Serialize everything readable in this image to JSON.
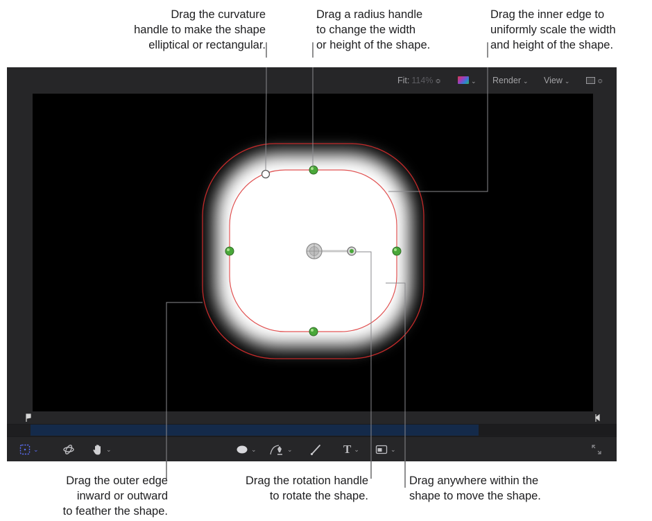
{
  "callouts": {
    "curvature": {
      "lines": [
        "Drag the curvature",
        "handle to make the shape",
        "elliptical or rectangular."
      ]
    },
    "radius": {
      "lines": [
        "Drag a radius handle",
        "to change the width",
        "or height of the shape."
      ]
    },
    "inner_edge": {
      "lines": [
        "Drag the inner edge to",
        "uniformly scale the width",
        "and height of the shape."
      ]
    },
    "outer_edge": {
      "lines": [
        "Drag the outer edge",
        "inward or outward",
        "to feather the shape."
      ]
    },
    "rotation": {
      "lines": [
        "Drag the rotation handle",
        "to rotate the shape."
      ]
    },
    "move": {
      "lines": [
        "Drag anywhere within the",
        "shape to move the shape."
      ]
    }
  },
  "viewer": {
    "fit_label": "Fit:",
    "fit_value": "114%",
    "updown_glyph": "≎",
    "render_label": "Render",
    "view_label": "View",
    "chevron_glyph": "⌄"
  },
  "colors": {
    "window_bg": "#262628",
    "canvas_bg": "#000000",
    "shape_outline": "#d23a3a",
    "handle_green": "#4aa83a",
    "timeline_bar": "#142a4a",
    "select_tool_accent": "#5a6cf0"
  },
  "icons": {
    "layout": "square-layout-icon",
    "select_tool": "dashed-transform-icon",
    "3d_tool": "3d-orbit-icon",
    "pan_tool": "hand-icon",
    "shape_tool": "ellipse-icon",
    "bezier_tool": "pen-icon",
    "paint_tool": "brush-icon",
    "text_tool": "T",
    "mask_tool": "mask-icon",
    "expand": "expand-arrows-icon"
  }
}
